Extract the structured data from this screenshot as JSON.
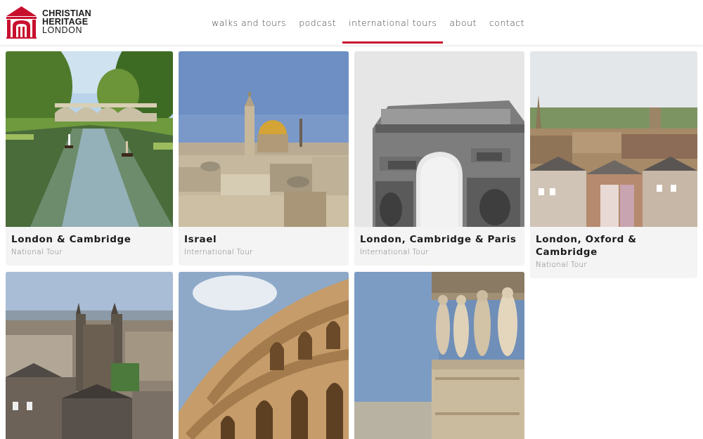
{
  "brand": {
    "line1": "CHRISTIAN",
    "line2": "HERITAGE",
    "line3": "LONDON",
    "color": "#c8102e"
  },
  "nav": {
    "items": [
      {
        "label": "walks and tours"
      },
      {
        "label": "podcast"
      },
      {
        "label": "international tours",
        "active": true
      },
      {
        "label": "about"
      },
      {
        "label": "contact"
      }
    ]
  },
  "tours": [
    {
      "title": "London & Cambridge",
      "subtitle": "National Tour",
      "image": "punting-on-river-cambridge"
    },
    {
      "title": "Israel",
      "subtitle": "International Tour",
      "image": "jerusalem-dome-of-the-rock"
    },
    {
      "title": "London, Cambridge & Paris",
      "subtitle": "International Tour",
      "image": "arc-de-triomphe"
    },
    {
      "title": "London, Oxford & Cambridge",
      "subtitle": "National Tour",
      "image": "oxford-rooftops"
    },
    {
      "title": "",
      "subtitle": "",
      "image": "edinburgh-skyline"
    },
    {
      "title": "",
      "subtitle": "",
      "image": "rome-colosseum"
    },
    {
      "title": "",
      "subtitle": "",
      "image": "athens-caryatids"
    }
  ]
}
